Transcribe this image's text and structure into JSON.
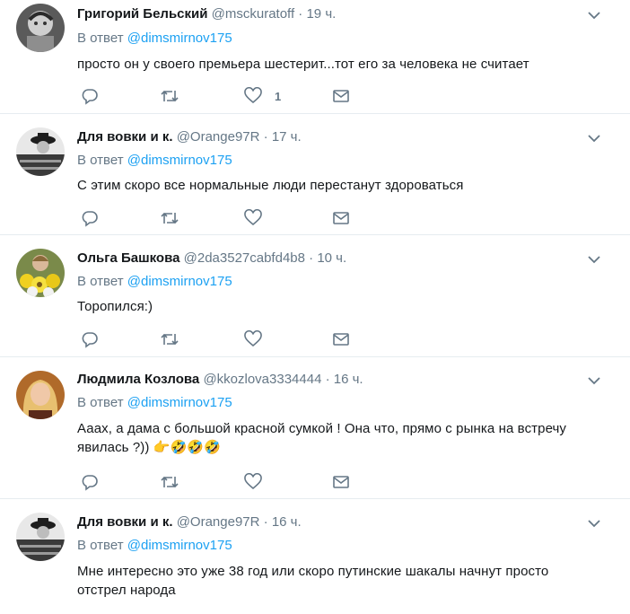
{
  "reply_prefix": "В ответ",
  "tweets": [
    {
      "name": "Григорий Бельский",
      "handle": "@msckuratoff",
      "dot": "·",
      "time": "19 ч.",
      "reply_to": "@dimsmirnov175",
      "lines": [
        "просто он у своего премьера шестерит...тот его за человека не считает"
      ],
      "like_count": "1",
      "avatar_icon": "avatar-bw-portrait"
    },
    {
      "name": "Для вовки и к.",
      "handle": "@Orange97R",
      "dot": "·",
      "time": "17 ч.",
      "reply_to": "@dimsmirnov175",
      "lines": [
        "С этим скоро все нормальные люди перестанут здороваться"
      ],
      "like_count": "",
      "avatar_icon": "avatar-bw-hat-woman"
    },
    {
      "name": "Ольга Башкова",
      "handle": "@2da3527cabfd4b8",
      "dot": "·",
      "time": "10 ч.",
      "reply_to": "@dimsmirnov175",
      "lines": [
        "Торопился:)"
      ],
      "like_count": "",
      "avatar_icon": "avatar-flowers"
    },
    {
      "name": "Людмила Козлова",
      "handle": "@kkozlova3334444",
      "dot": "·",
      "time": "16 ч.",
      "reply_to": "@dimsmirnov175",
      "lines": [
        "Ааах, а дама с большой красной сумкой ! Она что, прямо с рынка на встречу",
        "явилась ?))"
      ],
      "emoji": "👉🤣🤣🤣",
      "like_count": "",
      "avatar_icon": "avatar-blonde-woman"
    },
    {
      "name": "Для вовки и к.",
      "handle": "@Orange97R",
      "dot": "·",
      "time": "16 ч.",
      "reply_to": "@dimsmirnov175",
      "lines": [
        "Мне интересно это уже 38 год или скоро путинские шакалы начнут просто",
        "отстрел народа"
      ],
      "like_count": "",
      "avatar_icon": "avatar-bw-hat-woman"
    }
  ],
  "colors": {
    "link": "#1da1f2",
    "secondary": "#657786",
    "text": "#14171a",
    "divider": "#e6ecf0"
  }
}
